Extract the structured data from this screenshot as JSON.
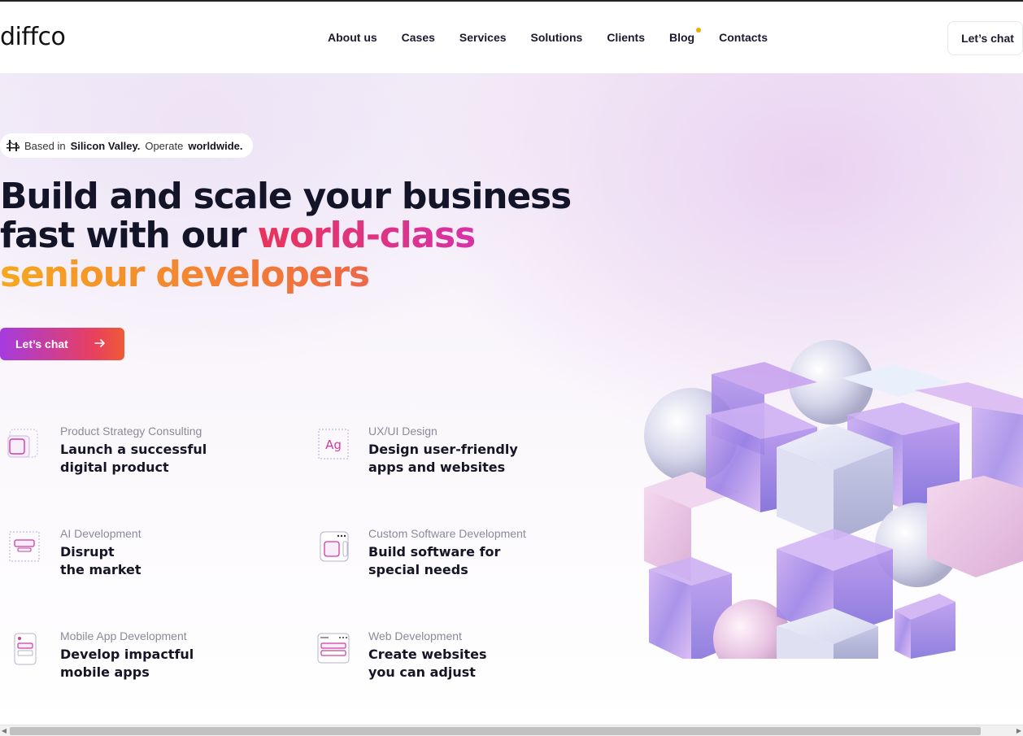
{
  "header": {
    "logo": "diffco",
    "nav": [
      "About us",
      "Cases",
      "Services",
      "Solutions",
      "Clients",
      "Blog",
      "Contacts"
    ],
    "cta": "Let’s chat",
    "blog_dot_color": "#f5a700"
  },
  "hero": {
    "badge": {
      "icon": "golden-gate-bridge-icon",
      "prefix": "Based in",
      "place": "Silicon Valley.",
      "middle": "Operate",
      "scope": "worldwide."
    },
    "headline": {
      "line1": "Build and scale your business",
      "line2_plain": "fast with our ",
      "line2_accent": "world-class",
      "line3_accent": "seniour developers"
    },
    "cta": "Let’s chat",
    "accent_colors": {
      "pink_start": "#e8345a",
      "pink_end": "#d633a6",
      "orange_start": "#f6a81d",
      "cta_start": "#a53be0",
      "cta_end": "#ee5a36"
    }
  },
  "services": [
    {
      "category": "Product Strategy Consulting",
      "title1": "Launch a successful",
      "title2": "digital product",
      "icon": "product-strategy-icon"
    },
    {
      "category": "UX/UI Design",
      "title1": "Design user-friendly",
      "title2": "apps and websites",
      "icon": "typography-ag-icon",
      "icon_text": "Ag"
    },
    {
      "category": "AI Development",
      "title1": "Disrupt",
      "title2": "the market",
      "icon": "ai-development-icon"
    },
    {
      "category": "Custom Software Development",
      "title1": "Build software for",
      "title2": "special needs",
      "icon": "custom-software-icon"
    },
    {
      "category": "Mobile App Development",
      "title1": "Develop impactful",
      "title2": "mobile apps",
      "icon": "mobile-app-icon"
    },
    {
      "category": "Web Development",
      "title1": "Create websites",
      "title2": "you can adjust",
      "icon": "web-development-icon"
    }
  ]
}
